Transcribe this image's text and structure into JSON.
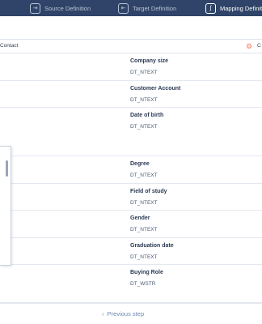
{
  "nav": {
    "steps": [
      {
        "label": "Source Definition",
        "icon": "source-icon",
        "glyph": "⇥"
      },
      {
        "label": "Target Definition",
        "icon": "target-icon",
        "glyph": "⇤"
      },
      {
        "label": "Mapping Definiti",
        "icon": "mapping-icon",
        "glyph": "ʃ"
      }
    ]
  },
  "contact_bar": {
    "left_label": "Contact",
    "hubspot_glyph": "⚙",
    "right_label": "C"
  },
  "fields": [
    {
      "name": "Company size",
      "type": "DT_NTEXT"
    },
    {
      "name": "Customer Account",
      "type": "DT_NTEXT"
    },
    {
      "name": "Date of birth",
      "type": "DT_NTEXT"
    },
    {
      "name": "Degree",
      "type": "DT_NTEXT"
    },
    {
      "name": "Field of study",
      "type": "DT_NTEXT"
    },
    {
      "name": "Gender",
      "type": "DT_NTEXT"
    },
    {
      "name": "Graduation date",
      "type": "DT_NTEXT"
    },
    {
      "name": "Buying Role",
      "type": "DT_WSTR"
    }
  ],
  "footer": {
    "prev_label": "Previous step",
    "prev_glyph": "‹"
  },
  "colors": {
    "nav_bg": "#2f4468",
    "hubspot": "#ff7a59",
    "link": "#6f87b0"
  }
}
